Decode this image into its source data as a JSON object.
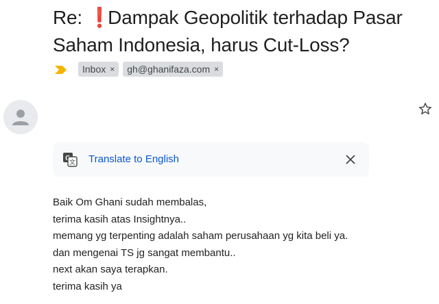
{
  "email": {
    "subject_prefix": "Re:",
    "subject_alert": "❗",
    "subject_line1": "Dampak Geopolitik terhadap Pasar",
    "subject_line2": "Saham Indonesia, harus Cut-Loss?"
  },
  "labels": [
    {
      "text": "Inbox",
      "remove": "×"
    },
    {
      "text": "gh@ghanifaza.com",
      "remove": "×"
    }
  ],
  "importance_marker": {
    "icon": "importance-marker-icon",
    "color": "#f4b400"
  },
  "translate_bar": {
    "link_text": "Translate to English",
    "icon": "translate-icon",
    "close_icon": "close-icon"
  },
  "star_icon": "star-outline-icon",
  "message": {
    "lines": [
      "Baik Om Ghani sudah membalas,",
      "terima kasih atas Insightnya..",
      "memang yg terpenting adalah saham perusahaan yg kita beli ya.",
      "dan mengenai TS jg sangat membantu..",
      "next akan saya terapkan.",
      "terima kasih ya"
    ]
  },
  "colors": {
    "link": "#0b57d0",
    "alert": "#d93025",
    "chip_bg": "#dadce0",
    "translate_bg": "#f8f9fa"
  }
}
